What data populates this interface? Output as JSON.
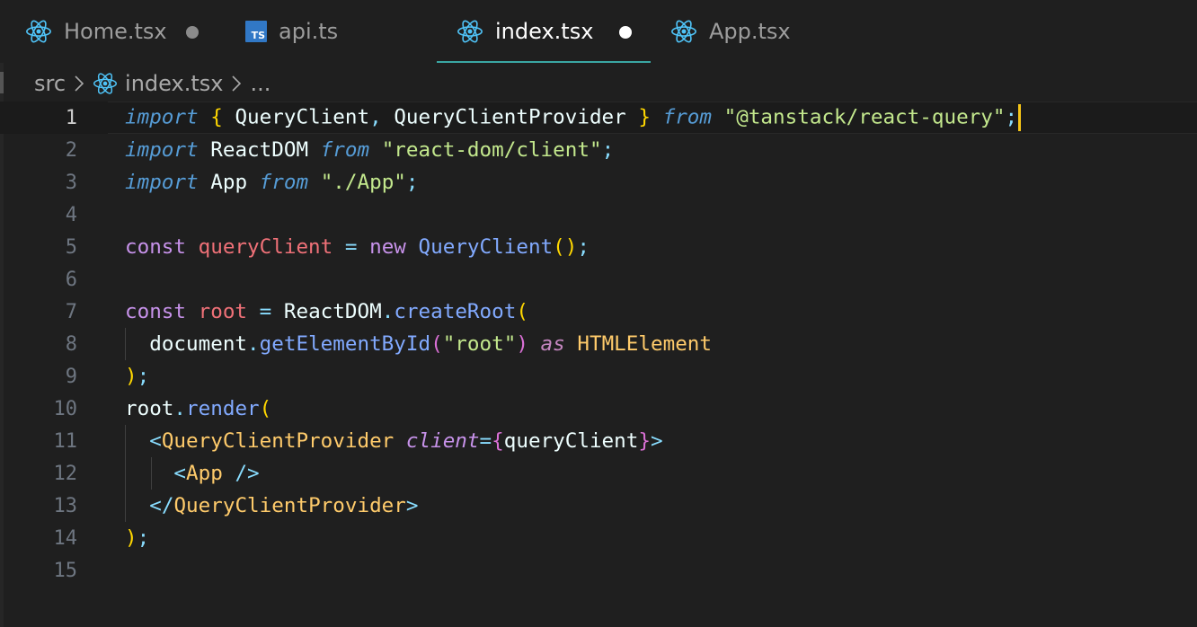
{
  "tabs": [
    {
      "label": "Home.tsx",
      "icon": "react-icon",
      "modified": true,
      "active": false
    },
    {
      "label": "api.ts",
      "icon": "typescript-icon",
      "icon_text": "TS",
      "modified": false,
      "active": false
    },
    {
      "label": "index.tsx",
      "icon": "react-icon",
      "modified": true,
      "active": true
    },
    {
      "label": "App.tsx",
      "icon": "react-icon",
      "modified": false,
      "active": false
    }
  ],
  "breadcrumb": {
    "folder": "src",
    "file": "index.tsx",
    "more": "..."
  },
  "colors": {
    "background": "#1f1f1f",
    "react_icon": "#4fc3f7",
    "ts_badge": "#3178c6",
    "active_tab_border": "#3aa7a3",
    "caret": "#f5c518"
  },
  "editor": {
    "current_line": 1,
    "lines": [
      {
        "n": "1"
      },
      {
        "n": "2"
      },
      {
        "n": "3"
      },
      {
        "n": "4"
      },
      {
        "n": "5"
      },
      {
        "n": "6"
      },
      {
        "n": "7"
      },
      {
        "n": "8"
      },
      {
        "n": "9"
      },
      {
        "n": "10"
      },
      {
        "n": "11"
      },
      {
        "n": "12"
      },
      {
        "n": "13"
      },
      {
        "n": "14"
      },
      {
        "n": "15"
      }
    ],
    "tokens": {
      "import": "import",
      "from": "from",
      "const": "const",
      "new": "new",
      "as": "as",
      "QueryClient": "QueryClient",
      "QueryClientProvider": "QueryClientProvider",
      "ReactDOM": "ReactDOM",
      "App": "App",
      "str_react_query": "\"@tanstack/react-query\"",
      "str_react_dom": "\"react-dom/client\"",
      "str_app": "\"./App\"",
      "queryClient": "queryClient",
      "root": "root",
      "createRoot": "createRoot",
      "document": "document",
      "getElementById": "getElementById",
      "str_root": "\"root\"",
      "HTMLElement": "HTMLElement",
      "render": "render",
      "client": "client"
    }
  }
}
